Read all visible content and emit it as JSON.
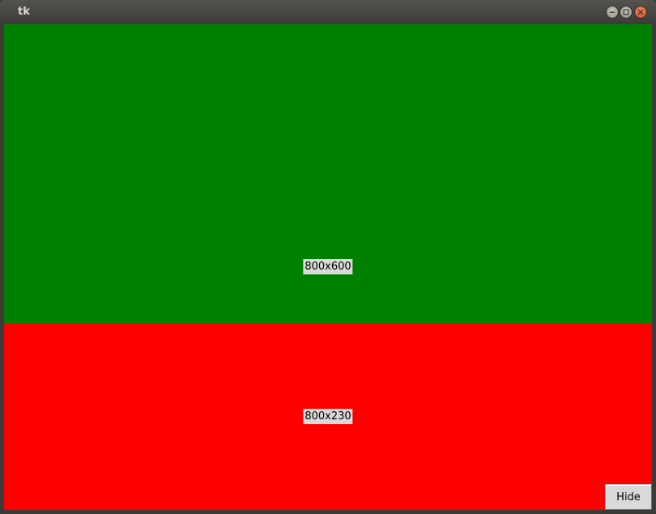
{
  "window": {
    "title": "tk"
  },
  "titlebar_buttons": {
    "minimize_icon": "minimize-icon",
    "maximize_icon": "maximize-icon",
    "close_icon": "close-icon"
  },
  "frames": {
    "top": {
      "label": "800x600",
      "color": "#008000"
    },
    "bottom": {
      "label": "800x230",
      "color": "#ff0000"
    }
  },
  "buttons": {
    "hide_label": "Hide"
  }
}
